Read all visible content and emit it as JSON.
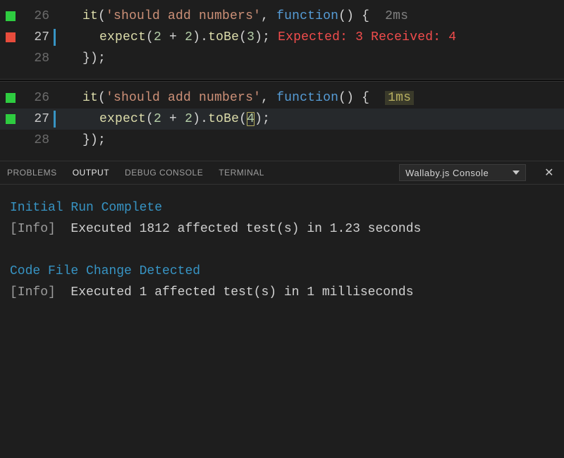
{
  "editor_panes": [
    {
      "lines": [
        {
          "num": "26",
          "marker": "green",
          "current": false,
          "tokens": [
            "it",
            "(",
            "'should add numbers'",
            ", ",
            "function",
            "()",
            " {",
            "  2ms"
          ],
          "classes": [
            "tok-fn",
            "tok-pun",
            "tok-str",
            "tok-pun",
            "tok-kw",
            "tok-pun",
            "tok-pun",
            "tok-time"
          ]
        },
        {
          "num": "27",
          "marker": "red",
          "current": true,
          "tokens": [
            "expect",
            "(",
            "2",
            " + ",
            "2",
            ").",
            "toBe",
            "(",
            "3",
            ");",
            " Expected: 3 Received: 4"
          ],
          "classes": [
            "tok-fn",
            "tok-pun",
            "tok-num",
            "tok-pun",
            "tok-num",
            "tok-pun",
            "tok-fn",
            "tok-pun",
            "tok-num",
            "tok-pun",
            "tok-err"
          ]
        },
        {
          "num": "28",
          "marker": "",
          "current": false,
          "tokens": [
            "});"
          ],
          "classes": [
            "tok-pun"
          ]
        }
      ]
    },
    {
      "lines": [
        {
          "num": "26",
          "marker": "green",
          "current": false,
          "tokens": [
            "it",
            "(",
            "'should add numbers'",
            ", ",
            "function",
            "()",
            " {  ",
            "1ms"
          ],
          "classes": [
            "tok-fn",
            "tok-pun",
            "tok-str",
            "tok-pun",
            "tok-kw",
            "tok-pun",
            "tok-pun",
            "time-badge"
          ]
        },
        {
          "num": "27",
          "marker": "green",
          "current": true,
          "highlight": true,
          "tokens": [
            "expect",
            "(",
            "2",
            " + ",
            "2",
            ").",
            "toBe",
            "(",
            "4",
            ");"
          ],
          "classes": [
            "tok-fn",
            "tok-pun",
            "tok-num",
            "tok-pun",
            "tok-num",
            "tok-pun",
            "tok-fn",
            "tok-pun",
            "hl-change",
            "tok-pun"
          ]
        },
        {
          "num": "28",
          "marker": "",
          "current": false,
          "tokens": [
            "});"
          ],
          "classes": [
            "tok-pun"
          ]
        }
      ]
    }
  ],
  "panel": {
    "tabs": [
      "PROBLEMS",
      "OUTPUT",
      "DEBUG CONSOLE",
      "TERMINAL"
    ],
    "active_tab": 1,
    "dropdown": "Wallaby.js Console"
  },
  "console": {
    "lines": [
      {
        "head": "Initial Run Complete"
      },
      {
        "info": "[Info]",
        "text": "  Executed 1812 affected test(s) in 1.23 seconds"
      },
      {
        "blank": true
      },
      {
        "head": "Code File Change Detected"
      },
      {
        "info": "[Info]",
        "text": "  Executed 1 affected test(s) in 1 milliseconds"
      }
    ]
  }
}
